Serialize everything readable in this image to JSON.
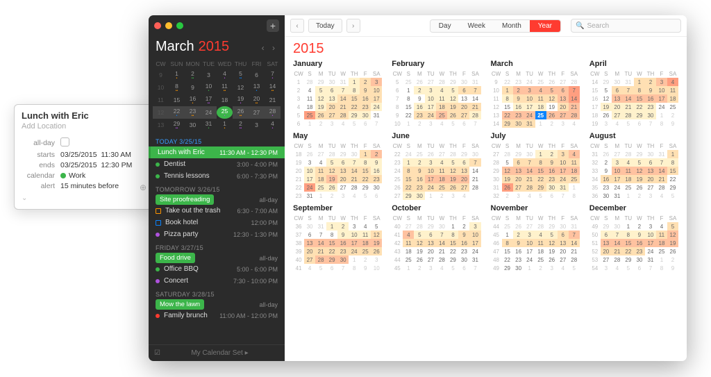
{
  "popover": {
    "title": "Lunch with Eric",
    "location_placeholder": "Add Location",
    "allday_label": "all-day",
    "starts_label": "starts",
    "starts_date": "03/25/2015",
    "starts_time": "11:30 AM",
    "ends_label": "ends",
    "ends_date": "03/25/2015",
    "ends_time": "12:30 PM",
    "calendar_label": "calendar",
    "calendar_value": "Work",
    "calendar_color": "#3cb54a",
    "alert_label": "alert",
    "alert_value": "15 minutes before"
  },
  "sidebar": {
    "month": "March",
    "year": "2015",
    "dow": [
      "CW",
      "SUN",
      "MON",
      "TUE",
      "WED",
      "THU",
      "FRI",
      "SAT"
    ],
    "footer": "My Calendar Set ▸"
  },
  "mini_weeks": [
    {
      "cw": "9",
      "d": [
        "1",
        "2",
        "3",
        "4",
        "5",
        "6",
        "7"
      ]
    },
    {
      "cw": "10",
      "d": [
        "8",
        "9",
        "10",
        "11",
        "12",
        "13",
        "14"
      ]
    },
    {
      "cw": "11",
      "d": [
        "15",
        "16",
        "17",
        "18",
        "19",
        "20",
        "21"
      ]
    },
    {
      "cw": "12",
      "d": [
        "22",
        "23",
        "24",
        "25",
        "26",
        "27",
        "28"
      ]
    },
    {
      "cw": "13",
      "d": [
        "29",
        "30",
        "31",
        "1",
        "2",
        "3",
        "4"
      ]
    }
  ],
  "agenda": [
    {
      "type": "hdr",
      "label": "TODAY 3/25/15",
      "cls": "b"
    },
    {
      "type": "pill",
      "label": "Lunch with Eric",
      "time": "11:30 AM - 12:30 PM"
    },
    {
      "type": "item",
      "color": "#3cb54a",
      "label": "Dentist",
      "time": "3:00 - 4:00 PM"
    },
    {
      "type": "item",
      "color": "#3cb54a",
      "label": "Tennis lessons",
      "time": "6:00 - 7:30 PM"
    },
    {
      "type": "hdr",
      "label": "TOMORROW 3/26/15",
      "cls": "g"
    },
    {
      "type": "badge",
      "bg": "#3cb54a",
      "label": "Site proofreading",
      "time": "all-day"
    },
    {
      "type": "sq",
      "color": "#ff9500",
      "label": "Take out the trash",
      "time": "6:30 - 7:00 AM"
    },
    {
      "type": "sq",
      "color": "#0a84ff",
      "label": "Book hotel",
      "time": "12:00 PM"
    },
    {
      "type": "item",
      "color": "#af52de",
      "label": "Pizza party",
      "time": "12:30 - 1:30 PM"
    },
    {
      "type": "hdr",
      "label": "FRIDAY 3/27/15",
      "cls": "g"
    },
    {
      "type": "badge",
      "bg": "#3cb54a",
      "label": "Food drive",
      "time": "all-day"
    },
    {
      "type": "item",
      "color": "#3cb54a",
      "label": "Office BBQ",
      "time": "5:00 - 6:00 PM"
    },
    {
      "type": "item",
      "color": "#af52de",
      "label": "Concert",
      "time": "7:30 - 10:00 PM"
    },
    {
      "type": "hdr",
      "label": "SATURDAY 3/28/15",
      "cls": "g"
    },
    {
      "type": "badge",
      "bg": "#3cb54a",
      "label": "Mow the lawn",
      "time": "all-day"
    },
    {
      "type": "item",
      "color": "#ff3b30",
      "label": "Family brunch",
      "time": "11:00 AM - 12:00 PM"
    }
  ],
  "toolbar": {
    "today": "Today",
    "views": [
      "Day",
      "Week",
      "Month",
      "Year"
    ],
    "active_view": "Year",
    "search_placeholder": "Search",
    "year_title": "2015"
  },
  "dow_short": [
    "CW",
    "S",
    "M",
    "TU",
    "W",
    "TH",
    "F",
    "SA"
  ],
  "months": [
    {
      "name": "January",
      "cw0": 1,
      "pre": [
        28,
        29,
        30,
        31
      ],
      "days": 31,
      "post": 7,
      "heat": {
        "1": 1,
        "2": 2,
        "3": 3,
        "5": 1,
        "6": 1,
        "7": 1,
        "8": 1,
        "9": 2,
        "10": 2,
        "12": 1,
        "13": 1,
        "14": 2,
        "15": 2,
        "16": 2,
        "17": 2,
        "19": 1,
        "20": 2,
        "21": 2,
        "22": 2,
        "23": 2,
        "24": 1,
        "25": 4,
        "26": 2,
        "27": 2,
        "28": 2,
        "29": 1,
        "30": 1
      }
    },
    {
      "name": "February",
      "cw0": 5,
      "pre": [
        25,
        26,
        27,
        28,
        29,
        30,
        31
      ],
      "days": 28,
      "post": 7,
      "heat": {
        "2": 1,
        "3": 1,
        "4": 1,
        "5": 1,
        "6": 2,
        "7": 2,
        "10": 1,
        "11": 1,
        "12": 1,
        "16": 1,
        "17": 1,
        "18": 2,
        "19": 2,
        "20": 2,
        "21": 2,
        "23": 2,
        "24": 2,
        "25": 3,
        "26": 2,
        "27": 2,
        "28": 1
      }
    },
    {
      "name": "March",
      "cw0": 9,
      "pre": [
        22,
        23,
        24,
        25,
        26,
        27,
        28
      ],
      "days": 31,
      "post": 4,
      "today": 25,
      "heat": {
        "1": 2,
        "2": 3,
        "3": 3,
        "4": 3,
        "5": 3,
        "6": 3,
        "7": 4,
        "8": 1,
        "9": 2,
        "10": 2,
        "11": 2,
        "12": 2,
        "13": 3,
        "14": 4,
        "16": 1,
        "17": 1,
        "18": 1,
        "20": 2,
        "21": 3,
        "22": 3,
        "23": 3,
        "24": 3,
        "26": 3,
        "27": 3,
        "28": 3,
        "29": 2,
        "30": 2,
        "31": 2
      }
    },
    {
      "name": "April",
      "cw0": 14,
      "pre": [
        29,
        30,
        31
      ],
      "days": 30,
      "post": 9,
      "heat": {
        "1": 2,
        "2": 2,
        "3": 3,
        "4": 4,
        "6": 2,
        "7": 2,
        "8": 2,
        "9": 2,
        "10": 2,
        "11": 2,
        "13": 3,
        "14": 3,
        "15": 3,
        "16": 3,
        "17": 3,
        "18": 2,
        "19": 1,
        "20": 1,
        "21": 1,
        "22": 1,
        "23": 1,
        "27": 1,
        "28": 1,
        "29": 1,
        "30": 1
      }
    },
    {
      "name": "May",
      "cw0": 18,
      "pre": [
        26,
        27,
        28,
        29,
        30
      ],
      "days": 31,
      "post": 6,
      "heat": {
        "1": 2,
        "2": 3,
        "5": 1,
        "6": 1,
        "7": 1,
        "8": 1,
        "9": 1,
        "10": 1,
        "11": 2,
        "12": 2,
        "13": 2,
        "14": 2,
        "15": 2,
        "16": 1,
        "17": 1,
        "18": 2,
        "19": 3,
        "20": 2,
        "21": 2,
        "22": 2,
        "23": 2,
        "24": 4,
        "25": 1,
        "26": 1
      }
    },
    {
      "name": "June",
      "cw0": 22,
      "pre": [
        24,
        25,
        26,
        27,
        28,
        29,
        30
      ],
      "days": 30,
      "post": 4,
      "heat": {
        "1": 1,
        "2": 1,
        "3": 1,
        "4": 1,
        "5": 1,
        "6": 1,
        "7": 2,
        "8": 2,
        "9": 2,
        "10": 2,
        "11": 2,
        "12": 2,
        "13": 2,
        "15": 2,
        "16": 2,
        "17": 3,
        "18": 3,
        "19": 3,
        "20": 3,
        "22": 2,
        "23": 2,
        "24": 2,
        "25": 2,
        "26": 2,
        "27": 2,
        "29": 1,
        "30": 1
      }
    },
    {
      "name": "July",
      "cw0": 27,
      "pre": [
        28,
        29,
        30
      ],
      "days": 31,
      "post": 8,
      "heat": {
        "1": 1,
        "2": 1,
        "3": 2,
        "4": 3,
        "6": 2,
        "7": 2,
        "8": 2,
        "9": 2,
        "10": 2,
        "11": 2,
        "12": 3,
        "13": 3,
        "14": 3,
        "15": 3,
        "16": 3,
        "17": 3,
        "18": 3,
        "19": 2,
        "20": 2,
        "21": 2,
        "22": 2,
        "23": 2,
        "24": 2,
        "25": 2,
        "26": 4,
        "27": 2,
        "28": 2,
        "29": 2,
        "30": 1,
        "31": 1
      }
    },
    {
      "name": "August",
      "cw0": 31,
      "pre": [
        26,
        27,
        28,
        29,
        30,
        31
      ],
      "days": 31,
      "post": 5,
      "heat": {
        "1": 2,
        "3": 1,
        "4": 1,
        "5": 1,
        "6": 1,
        "7": 1,
        "8": 1,
        "10": 3,
        "11": 3,
        "12": 3,
        "13": 3,
        "14": 3,
        "15": 2,
        "16": 2,
        "17": 2,
        "18": 2,
        "19": 2,
        "20": 2,
        "21": 2
      }
    },
    {
      "name": "September",
      "cw0": 36,
      "pre": [
        30,
        31
      ],
      "days": 30,
      "post": 10,
      "heat": {
        "1": 1,
        "2": 1,
        "9": 1,
        "10": 1,
        "11": 1,
        "12": 2,
        "13": 3,
        "14": 3,
        "15": 3,
        "16": 3,
        "17": 3,
        "18": 3,
        "19": 3,
        "20": 2,
        "21": 2,
        "22": 2,
        "23": 2,
        "24": 2,
        "25": 2,
        "26": 2,
        "27": 2,
        "28": 3,
        "29": 3,
        "30": 3
      }
    },
    {
      "name": "October",
      "cw0": 40,
      "pre": [
        27,
        28,
        29,
        30
      ],
      "days": 31,
      "post": 7,
      "heat": {
        "3": 1,
        "4": 3,
        "5": 1,
        "6": 1,
        "7": 1,
        "8": 1,
        "9": 2,
        "10": 2,
        "11": 2,
        "12": 2,
        "13": 2,
        "14": 2,
        "15": 2,
        "16": 2,
        "17": 2
      }
    },
    {
      "name": "November",
      "cw0": 44,
      "pre": [
        25,
        26,
        27,
        28,
        29,
        30,
        31
      ],
      "days": 30,
      "post": 5,
      "heat": {
        "2": 1,
        "3": 1,
        "4": 1,
        "5": 1,
        "6": 2,
        "7": 3,
        "8": 2,
        "9": 2,
        "10": 2,
        "11": 2,
        "12": 2,
        "13": 2,
        "14": 2
      }
    },
    {
      "name": "December",
      "cw0": 49,
      "pre": [
        29,
        30
      ],
      "days": 31,
      "post": 9,
      "heat": {
        "5": 2,
        "6": 1,
        "7": 1,
        "8": 1,
        "9": 1,
        "10": 1,
        "11": 2,
        "12": 3,
        "13": 3,
        "14": 3,
        "15": 3,
        "16": 3,
        "17": 3,
        "18": 3,
        "19": 3,
        "20": 2,
        "21": 2,
        "22": 2,
        "23": 2
      }
    }
  ]
}
